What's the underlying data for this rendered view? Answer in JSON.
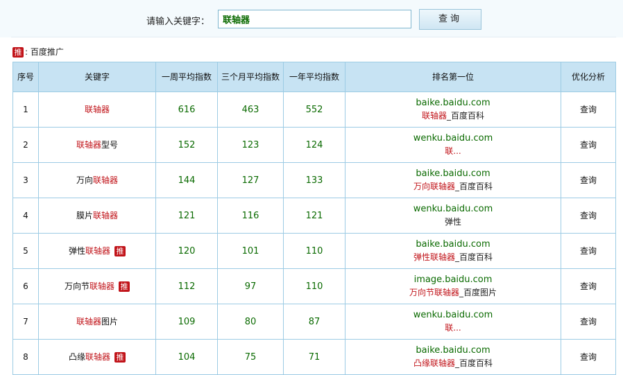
{
  "search": {
    "label": "请输入关键字：",
    "value": "联轴器",
    "button": "查询"
  },
  "promo": {
    "badge": "推",
    "text": "百度推广"
  },
  "table": {
    "headers": [
      "序号",
      "关键字",
      "一周平均指数",
      "三个月平均指数",
      "一年平均指数",
      "排名第一位",
      "优化分析"
    ],
    "rows": [
      {
        "index": "1",
        "kw_pre": "",
        "kw_hl": "联轴器",
        "kw_post": "",
        "promoted": false,
        "week": "616",
        "quarter": "463",
        "year": "552",
        "rank_domain": "baike.baidu.com",
        "rank_pre": "",
        "rank_hl": "联轴器",
        "rank_post": "_百度百科",
        "action": "查询"
      },
      {
        "index": "2",
        "kw_pre": "",
        "kw_hl": "联轴器",
        "kw_post": "型号",
        "promoted": false,
        "week": "152",
        "quarter": "123",
        "year": "124",
        "rank_domain": "wenku.baidu.com",
        "rank_pre": "",
        "rank_hl": "联...",
        "rank_post": "",
        "action": "查询"
      },
      {
        "index": "3",
        "kw_pre": "万向",
        "kw_hl": "联轴器",
        "kw_post": "",
        "promoted": false,
        "week": "144",
        "quarter": "127",
        "year": "133",
        "rank_domain": "baike.baidu.com",
        "rank_pre": "",
        "rank_hl": "万向联轴器",
        "rank_post": "_百度百科",
        "action": "查询"
      },
      {
        "index": "4",
        "kw_pre": "膜片",
        "kw_hl": "联轴器",
        "kw_post": "",
        "promoted": false,
        "week": "121",
        "quarter": "116",
        "year": "121",
        "rank_domain": "wenku.baidu.com",
        "rank_pre": "弹性",
        "rank_hl": "",
        "rank_post": "",
        "action": "查询"
      },
      {
        "index": "5",
        "kw_pre": "弹性",
        "kw_hl": "联轴器",
        "kw_post": "",
        "promoted": true,
        "week": "120",
        "quarter": "101",
        "year": "110",
        "rank_domain": "baike.baidu.com",
        "rank_pre": "",
        "rank_hl": "弹性联轴器",
        "rank_post": "_百度百科",
        "action": "查询"
      },
      {
        "index": "6",
        "kw_pre": "万向节",
        "kw_hl": "联轴器",
        "kw_post": "",
        "promoted": true,
        "week": "112",
        "quarter": "97",
        "year": "110",
        "rank_domain": "image.baidu.com",
        "rank_pre": "",
        "rank_hl": "万向节联轴器",
        "rank_post": "_百度图片",
        "action": "查询"
      },
      {
        "index": "7",
        "kw_pre": "",
        "kw_hl": "联轴器",
        "kw_post": "图片",
        "promoted": false,
        "week": "109",
        "quarter": "80",
        "year": "87",
        "rank_domain": "wenku.baidu.com",
        "rank_pre": "",
        "rank_hl": "联...",
        "rank_post": "",
        "action": "查询"
      },
      {
        "index": "8",
        "kw_pre": "凸缘",
        "kw_hl": "联轴器",
        "kw_post": "",
        "promoted": true,
        "week": "104",
        "quarter": "75",
        "year": "71",
        "rank_domain": "baike.baidu.com",
        "rank_pre": "",
        "rank_hl": "凸缘联轴器",
        "rank_post": "_百度百科",
        "action": "查询"
      }
    ]
  }
}
